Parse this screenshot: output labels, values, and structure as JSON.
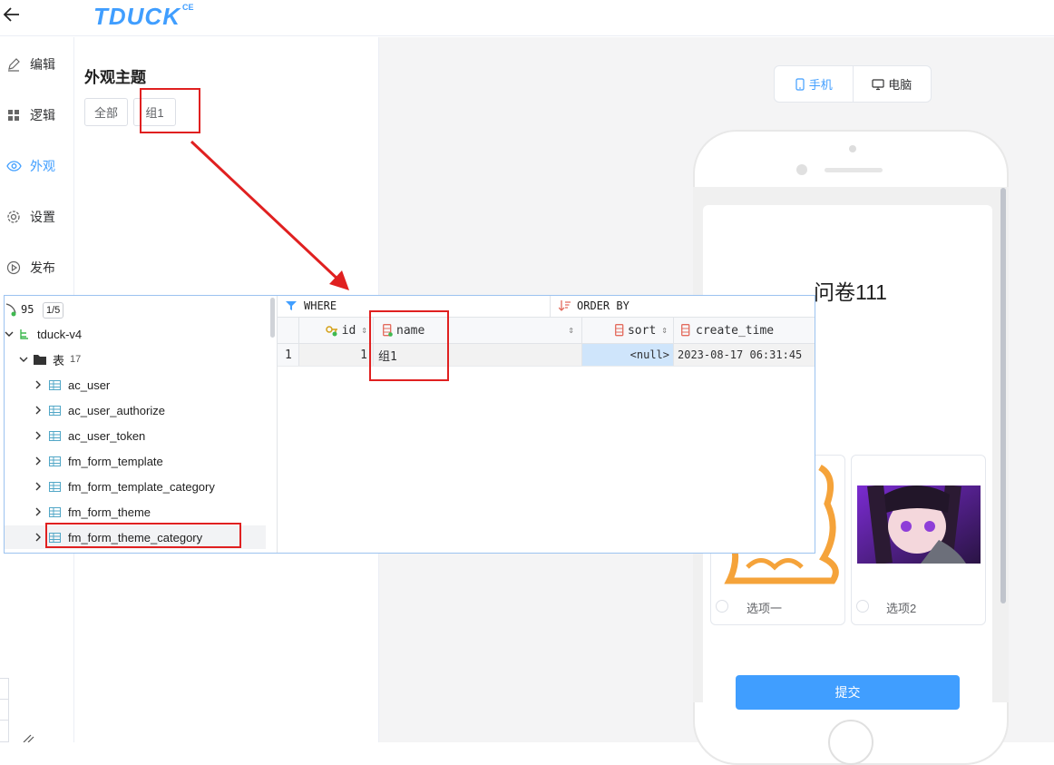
{
  "header": {
    "logo_text": "TDUCK",
    "logo_sup": "CE"
  },
  "nav": {
    "items": [
      {
        "label": "编辑",
        "icon": "edit-icon"
      },
      {
        "label": "逻辑",
        "icon": "logic-grid-icon"
      },
      {
        "label": "外观",
        "icon": "eye-icon",
        "active": true
      },
      {
        "label": "设置",
        "icon": "gear-icon"
      },
      {
        "label": "发布",
        "icon": "publish-icon"
      }
    ]
  },
  "panel": {
    "title": "外观主题",
    "chips": [
      "全部",
      "组1"
    ]
  },
  "preview": {
    "device_toggle": {
      "mobile": "手机",
      "desktop": "电脑"
    },
    "form_title": "问卷111",
    "options": [
      "选项一",
      "选项2"
    ],
    "submit": "提交"
  },
  "db_tree": {
    "connection_count": "95",
    "connection_badge": "1/5",
    "schema": "tduck-v4",
    "tables_folder": "表",
    "tables_count": "17",
    "tables": [
      "ac_user",
      "ac_user_authorize",
      "ac_user_token",
      "fm_form_template",
      "fm_form_template_category",
      "fm_form_theme",
      "fm_form_theme_category"
    ]
  },
  "db_grid": {
    "where_label": "WHERE",
    "orderby_label": "ORDER BY",
    "columns": [
      "id",
      "name",
      "sort",
      "create_time"
    ],
    "rows": [
      {
        "num": "1",
        "id": "1",
        "name": "组1",
        "sort": "<null>",
        "create_time": "2023-08-17 06:31:45"
      }
    ]
  },
  "colors": {
    "accent": "#409eff",
    "annotation_red": "#e02020"
  }
}
